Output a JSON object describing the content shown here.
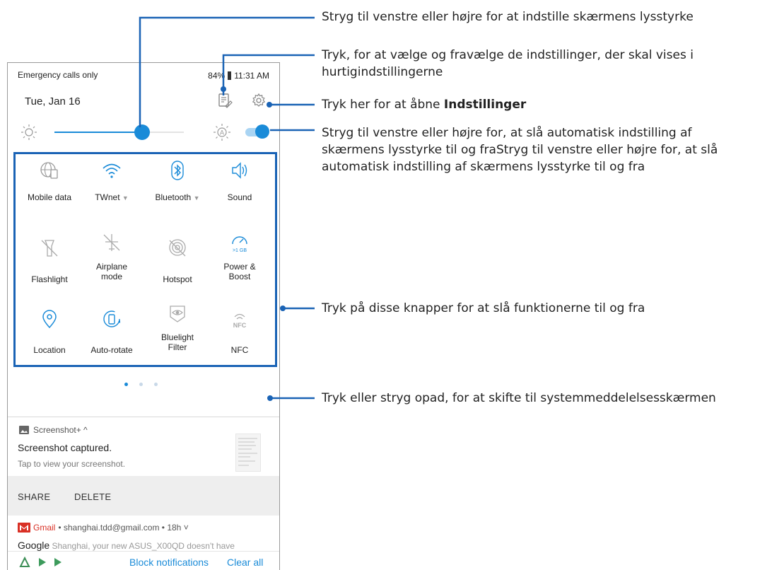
{
  "status_bar": {
    "left": "Emergency calls only",
    "battery": "84%",
    "time": "11:31 AM"
  },
  "header": {
    "date": "Tue, Jan 16"
  },
  "brightness": {
    "level": 0.68,
    "auto": true
  },
  "tiles": [
    {
      "label": "Mobile data",
      "icon": "globe-sim-icon",
      "active": false
    },
    {
      "label": "TWnet",
      "icon": "wifi-icon",
      "active": true,
      "dropdown": true
    },
    {
      "label": "Bluetooth",
      "icon": "bluetooth-icon",
      "active": true,
      "dropdown": true
    },
    {
      "label": "Sound",
      "icon": "speaker-icon",
      "active": true
    },
    {
      "label": "Flashlight",
      "icon": "flashlight-off-icon",
      "active": false
    },
    {
      "label": "Airplane mode",
      "icon": "airplane-off-icon",
      "active": false
    },
    {
      "label": "Hotspot",
      "icon": "hotspot-off-icon",
      "active": false
    },
    {
      "label": "Power & Boost",
      "icon": "boost-gauge-icon",
      "active": true,
      "badge": ">1 GB"
    },
    {
      "label": "Location",
      "icon": "location-pin-icon",
      "active": true
    },
    {
      "label": "Auto-rotate",
      "icon": "auto-rotate-icon",
      "active": true
    },
    {
      "label": "Bluelight Filter",
      "icon": "eye-filter-icon",
      "active": false
    },
    {
      "label": "NFC",
      "icon": "nfc-icon",
      "active": false
    }
  ],
  "page_dots": 3,
  "notification": {
    "app": "Screenshot+ ^",
    "title": "Screenshot captured.",
    "subtitle": "Tap to view your screenshot.",
    "actions": [
      "SHARE",
      "DELETE"
    ]
  },
  "gmail": {
    "app": "Gmail",
    "meta": "• shanghai.tdd@gmail.com • 18h ˅",
    "preview_sender": "Google",
    "preview_text": "Shanghai, your new ASUS_X00QD doesn't have"
  },
  "bottom_bar": {
    "block": "Block notifications",
    "clear": "Clear all"
  },
  "callouts": {
    "brightness": "Stryg til venstre eller højre for at indstille skærmens lysstyrke",
    "edit_line1": "Tryk, for at vælge og fravælge de indstillinger, der skal vises i",
    "edit_line2": "hurtigindstillingerne",
    "settings_prefix": "Tryk her for at åbne ",
    "settings_bold": "Indstillinger",
    "auto_line1": "Stryg til venstre eller højre for, at slå automatisk indstilling af",
    "auto_line2": "skærmens lysstyrke til og fraStryg til venstre eller højre for, at slå",
    "auto_line3": "automatisk indstilling af skærmens lysstyrke til og fra",
    "tiles": "Tryk på disse knapper for at slå funktionerne til og fra",
    "swipe": "Tryk eller stryg opad, for at skifte til systemmeddelelsesskærmen"
  },
  "colors": {
    "accent": "#1a8bd8",
    "callout_line": "#1a63b5",
    "gmail_red": "#d93025"
  }
}
